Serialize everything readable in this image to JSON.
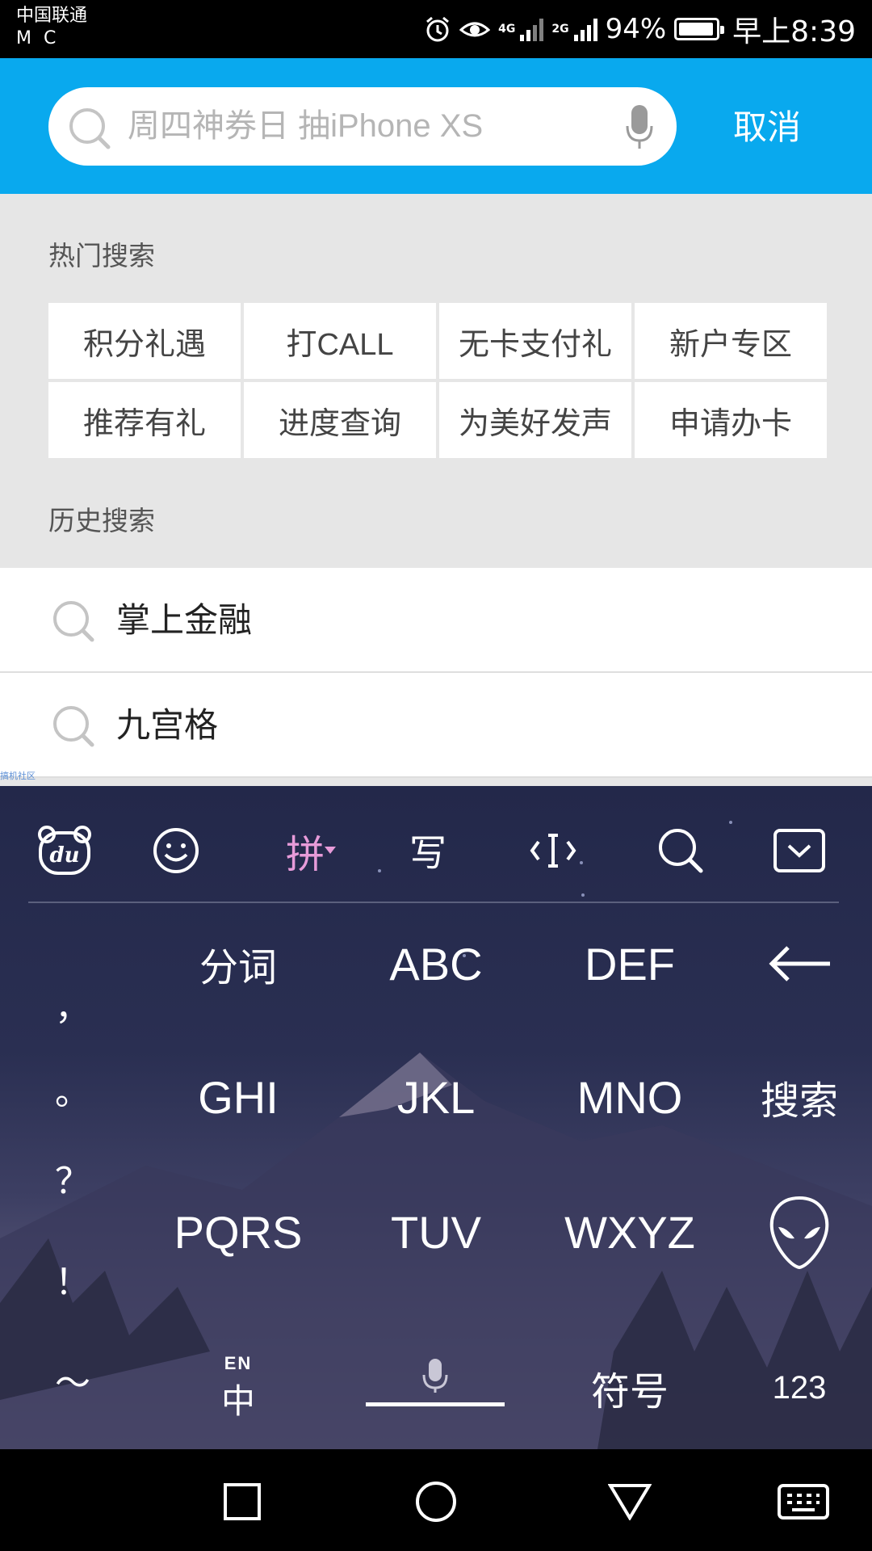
{
  "status_bar": {
    "carrier_line1": "中国联通",
    "carrier_line2": "M C",
    "net_4g": "4G",
    "net_2g": "2G",
    "battery": "94%",
    "battery_level": 0.94,
    "time": "早上8:39"
  },
  "search": {
    "placeholder": "周四神券日 抽iPhone XS",
    "value": "",
    "cancel_label": "取消"
  },
  "hot": {
    "title": "热门搜索",
    "items": [
      "积分礼遇",
      "打CALL",
      "无卡支付礼",
      "新户专区",
      "推荐有礼",
      "进度查询",
      "为美好发声",
      "申请办卡"
    ]
  },
  "history": {
    "title": "历史搜索",
    "items": [
      "掌上金融",
      "九宫格"
    ]
  },
  "watermark": "搞机社区",
  "keyboard": {
    "toolbar": {
      "pinyin": "拼",
      "handwrite": "写"
    },
    "punct": [
      "，",
      "。",
      "？",
      "！",
      "～"
    ],
    "row1": [
      "分词",
      "ABC",
      "DEF"
    ],
    "row2": [
      "GHI",
      "JKL",
      "MNO"
    ],
    "row2_action": "搜索",
    "row3": [
      "PQRS",
      "TUV",
      "WXYZ"
    ],
    "lang_top": "EN",
    "lang_bottom": "中",
    "symbols": "符号",
    "numbers": "123"
  },
  "colors": {
    "header": "#09a9ee",
    "page_bg": "#e6e6e6",
    "pinyin_accent": "#e79bd9"
  }
}
